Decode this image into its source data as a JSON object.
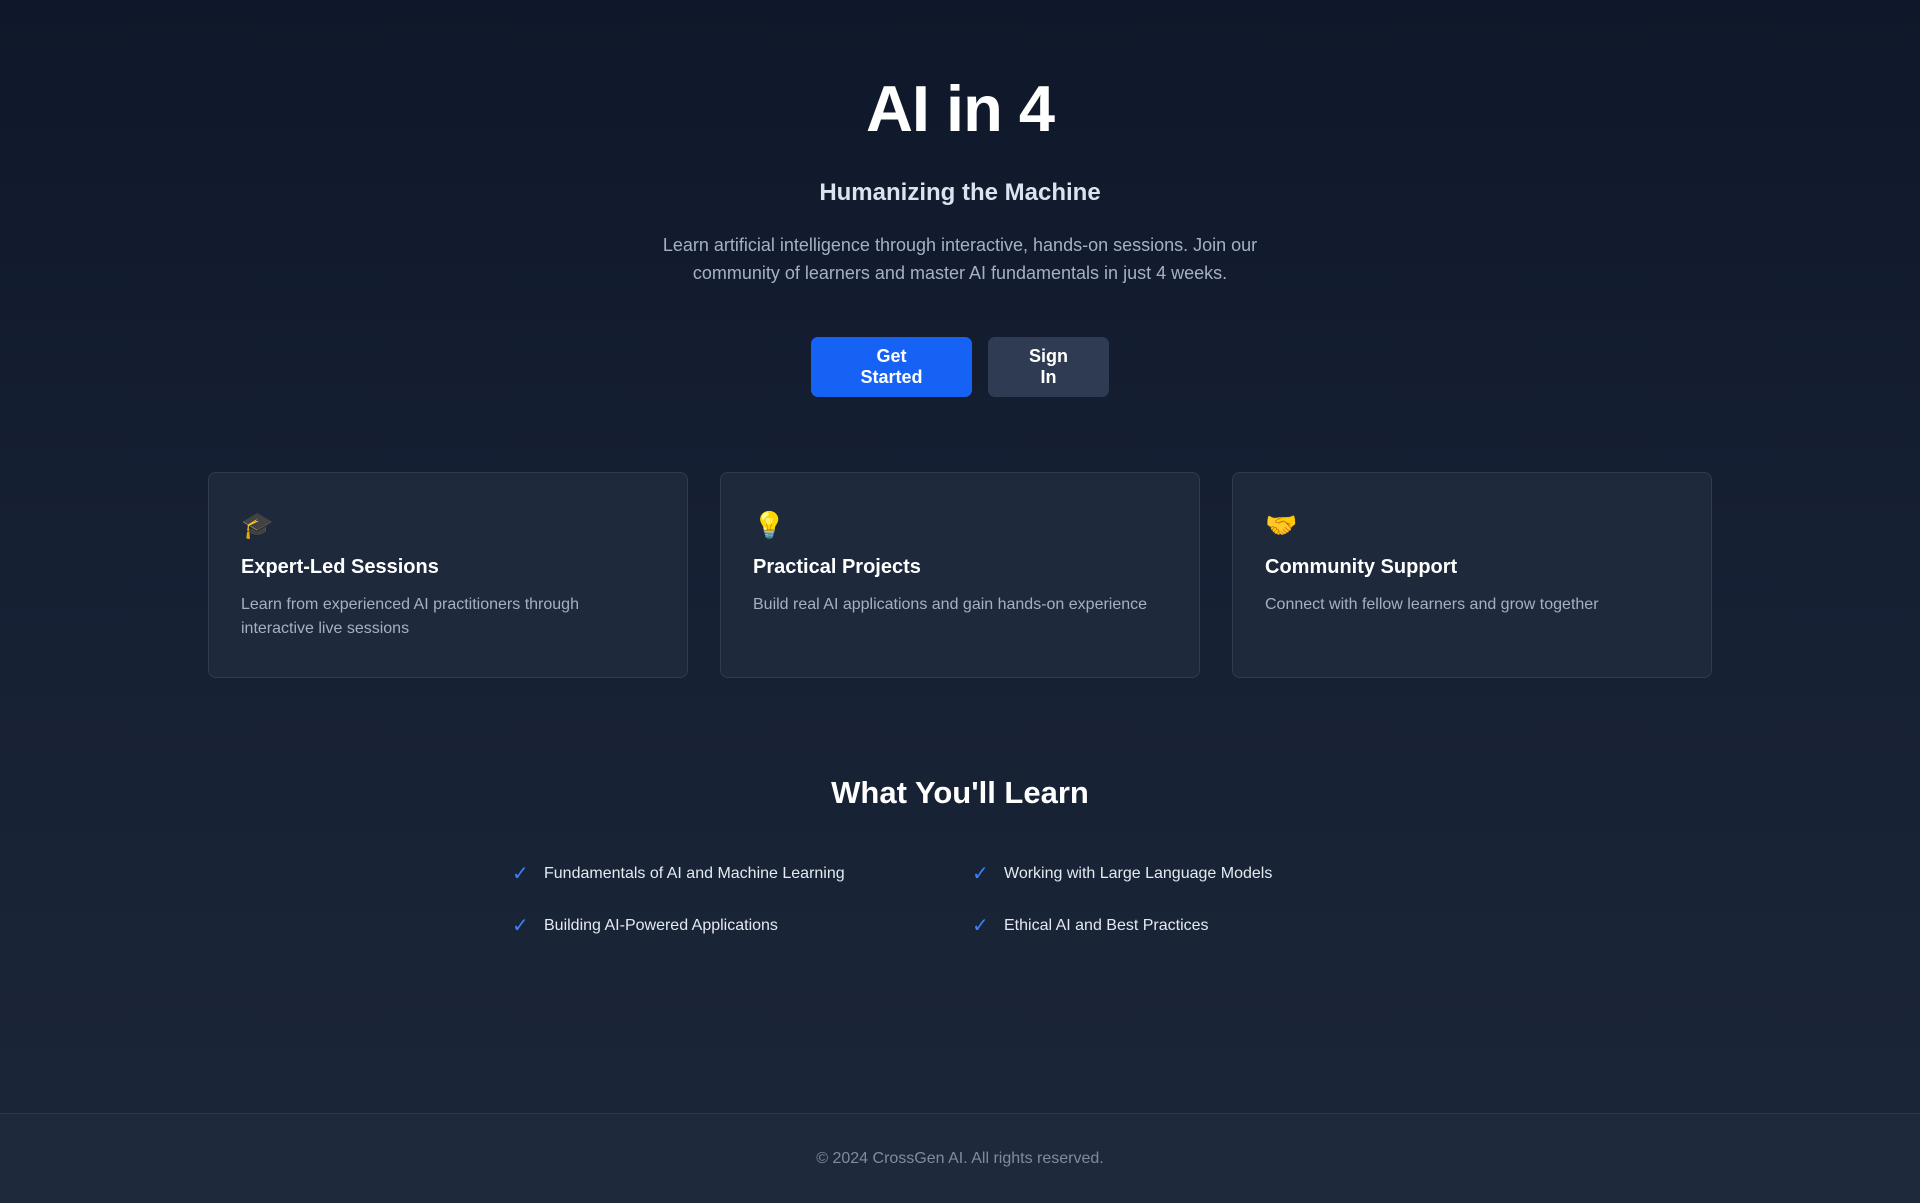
{
  "hero": {
    "title": "AI in 4",
    "subtitle": "Humanizing the Machine",
    "description": "Learn artificial intelligence through interactive, hands-on sessions. Join our community of learners and master AI fundamentals in just 4 weeks.",
    "primary_button": "Get Started",
    "secondary_button": "Sign In"
  },
  "features": [
    {
      "icon": "🎓",
      "icon_name": "graduation-cap-icon",
      "title": "Expert-Led Sessions",
      "text": "Learn from experienced AI practitioners through interactive live sessions"
    },
    {
      "icon": "💡",
      "icon_name": "lightbulb-icon",
      "title": "Practical Projects",
      "text": "Build real AI applications and gain hands-on experience"
    },
    {
      "icon": "🤝",
      "icon_name": "handshake-icon",
      "title": "Community Support",
      "text": "Connect with fellow learners and grow together"
    }
  ],
  "learn": {
    "title": "What You'll Learn",
    "check_glyph": "✓",
    "items": [
      "Fundamentals of AI and Machine Learning",
      "Working with Large Language Models",
      "Building AI-Powered Applications",
      "Ethical AI and Best Practices"
    ]
  },
  "footer": {
    "text": "© 2024 CrossGen AI. All rights reserved."
  },
  "colors": {
    "background": "#0f172a",
    "accent": "#1662f5",
    "secondary_button": "#2e3b52",
    "card": "#1e293b",
    "check": "#3b82f6"
  }
}
